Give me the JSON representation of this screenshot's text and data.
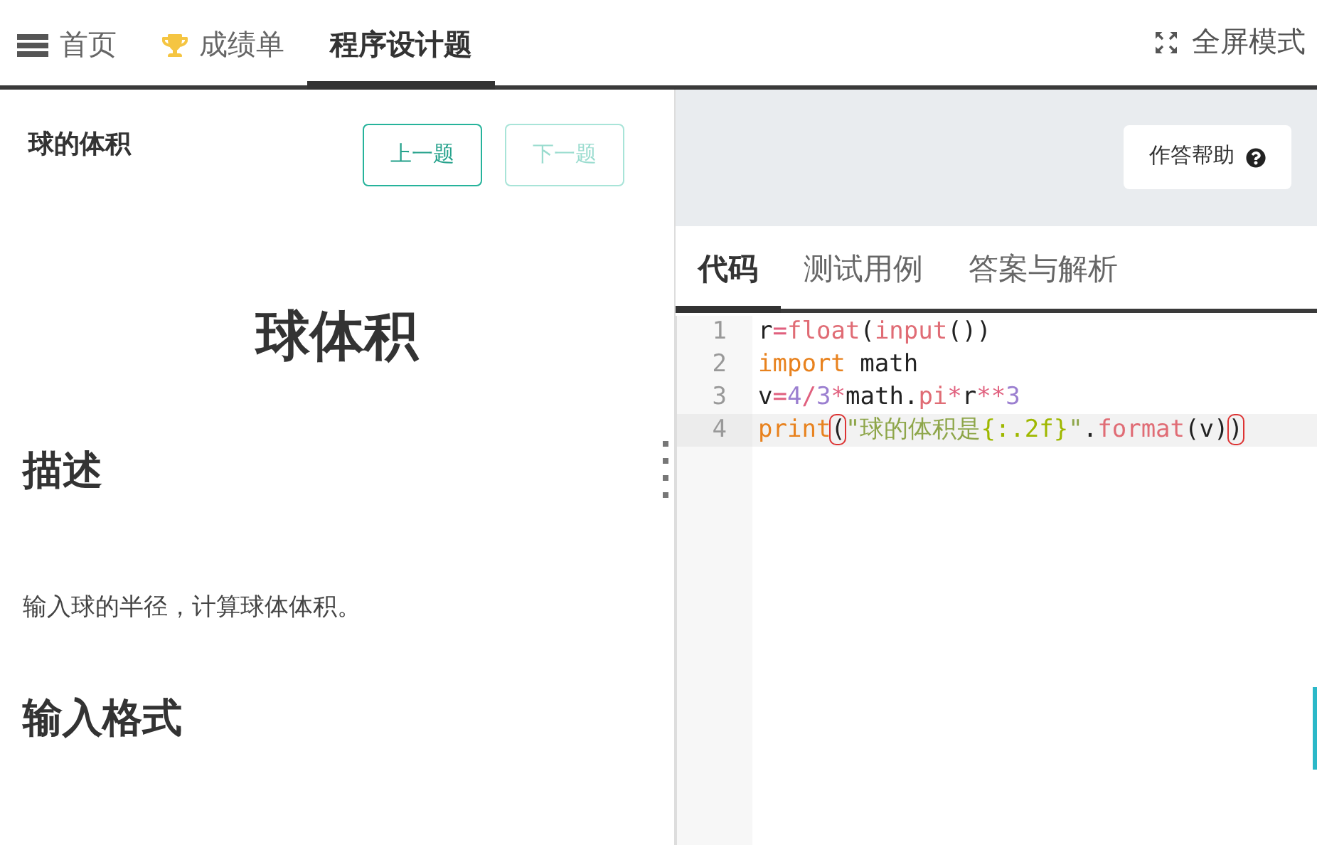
{
  "nav": {
    "items": [
      {
        "label": "首页",
        "kind": "menu",
        "selected": false
      },
      {
        "label": "成绩单",
        "kind": "trophy",
        "selected": false
      },
      {
        "label": "程序设计题",
        "kind": "plain",
        "selected": true
      }
    ],
    "fullscreen": "全屏模式"
  },
  "problem": {
    "name": "球的体积",
    "buttons": [
      {
        "label": "上一题",
        "disabled": false
      },
      {
        "label": "下一题",
        "disabled": true
      }
    ],
    "title": "球体积",
    "sections": [
      {
        "heading": "描述",
        "text": "输入球的半径，计算球体体积。"
      },
      {
        "heading": "输入格式"
      }
    ]
  },
  "editor": {
    "help": "作答帮助",
    "tabs": [
      {
        "label": "代码",
        "selected": true
      },
      {
        "label": "测试用例",
        "selected": false
      },
      {
        "label": "答案与解析",
        "selected": false
      }
    ],
    "lines": [
      {
        "number": "1",
        "selected": false,
        "tokens": [
          {
            "kind": "plain",
            "text": "r"
          },
          {
            "kind": "operator",
            "text": "="
          },
          {
            "kind": "builtin",
            "text": "float"
          },
          {
            "kind": "plain",
            "text": "("
          },
          {
            "kind": "builtin",
            "text": "input"
          },
          {
            "kind": "plain",
            "text": "())"
          }
        ]
      },
      {
        "number": "2",
        "selected": false,
        "tokens": [
          {
            "kind": "keyword",
            "text": "import"
          },
          {
            "kind": "plain",
            "text": " math"
          }
        ]
      },
      {
        "number": "3",
        "selected": false,
        "tokens": [
          {
            "kind": "plain",
            "text": "v"
          },
          {
            "kind": "operator",
            "text": "="
          },
          {
            "kind": "number",
            "text": "4"
          },
          {
            "kind": "operator",
            "text": "/"
          },
          {
            "kind": "number",
            "text": "3"
          },
          {
            "kind": "operator",
            "text": "*"
          },
          {
            "kind": "plain",
            "text": "math."
          },
          {
            "kind": "builtin",
            "text": "pi"
          },
          {
            "kind": "operator",
            "text": "*"
          },
          {
            "kind": "plain",
            "text": "r"
          },
          {
            "kind": "operator",
            "text": "**"
          },
          {
            "kind": "number",
            "text": "3"
          }
        ]
      },
      {
        "number": "4",
        "selected": true,
        "tokens": [
          {
            "kind": "keyword",
            "text": "print"
          },
          {
            "kind": "bracket",
            "text": "("
          },
          {
            "kind": "string",
            "text": "\"球的体积是"
          },
          {
            "kind": "format",
            "text": "{:.2f}"
          },
          {
            "kind": "string",
            "text": "\""
          },
          {
            "kind": "plain",
            "text": "."
          },
          {
            "kind": "builtin",
            "text": "format"
          },
          {
            "kind": "plain",
            "text": "(v)"
          },
          {
            "kind": "bracket",
            "text": ")"
          }
        ]
      }
    ]
  }
}
